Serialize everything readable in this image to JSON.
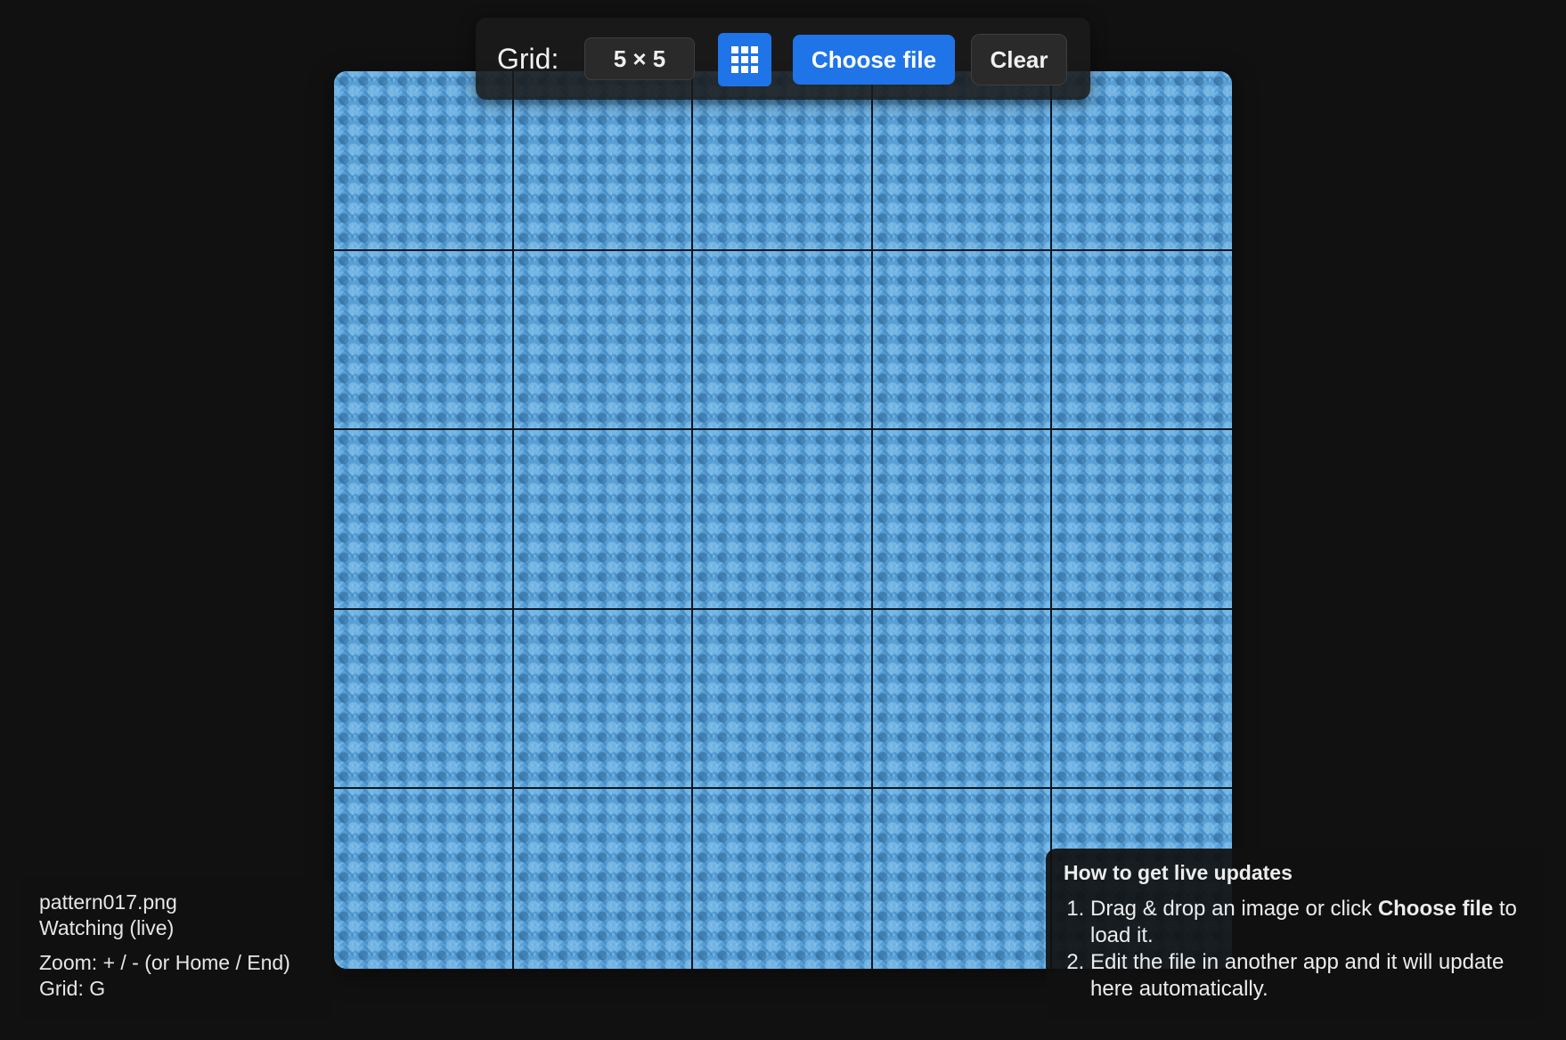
{
  "toolbar": {
    "grid_label": "Grid:",
    "grid_value": "5 × 5",
    "grid_toggle_icon": "grid-icon",
    "choose_label": "Choose file",
    "clear_label": "Clear"
  },
  "canvas": {
    "rows": 5,
    "cols": 5,
    "tile_color": "#5a9fd4",
    "grid_line_color": "#0c1824"
  },
  "info": {
    "filename": "pattern017.png",
    "status": "Watching (live)",
    "zoom_hint": "Zoom: + / - (or Home / End)",
    "grid_hint": "Grid: G"
  },
  "help": {
    "title": "How to get live updates",
    "step1_pre": "Drag & drop an image or click ",
    "step1_bold": "Choose file",
    "step1_post": " to load it.",
    "step2": "Edit the file in another app and it will update here automatically."
  },
  "colors": {
    "accent": "#1f74e8",
    "background": "#111111"
  }
}
